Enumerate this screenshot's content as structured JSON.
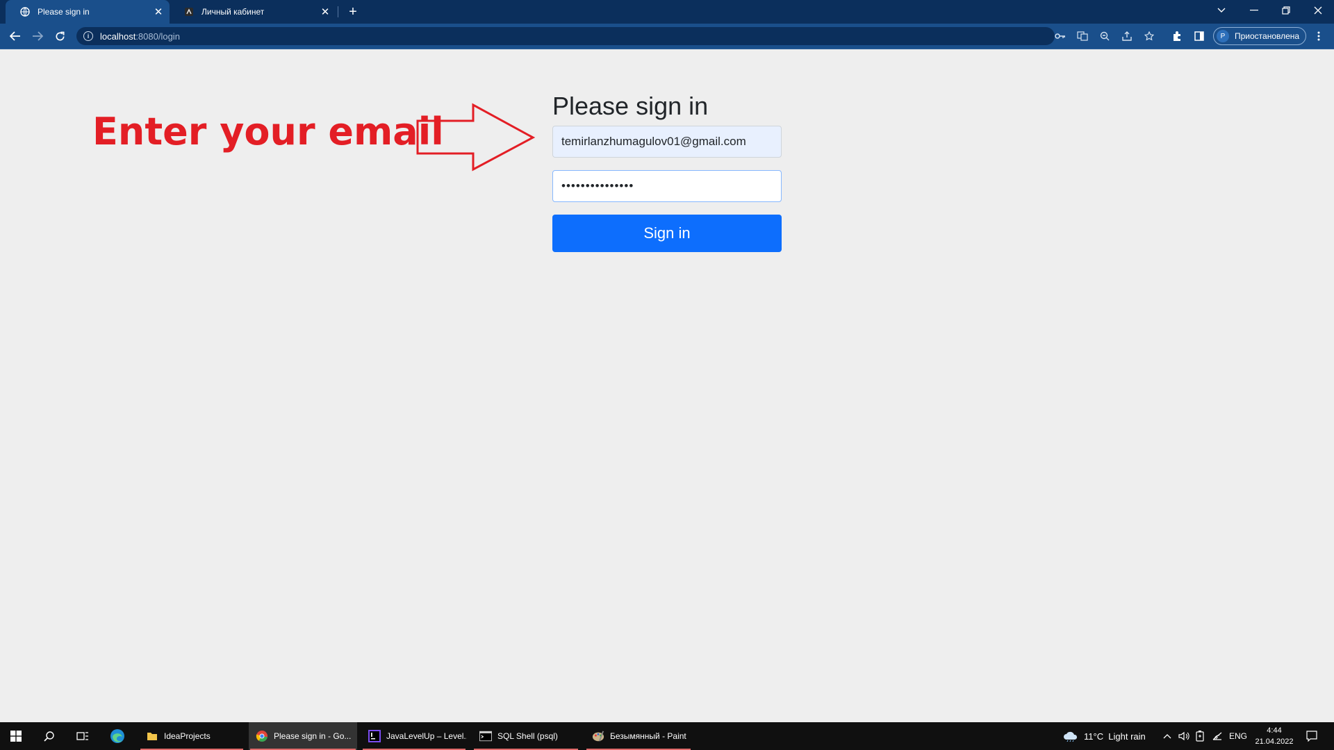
{
  "browser": {
    "tabs": [
      {
        "title": "Please sign in",
        "active": true
      },
      {
        "title": "Личный кабинет",
        "active": false
      }
    ],
    "address": {
      "host": "localhost",
      "path": ":8080/login"
    },
    "profile": {
      "initial": "P",
      "label": "Приостановлена"
    },
    "icons": [
      "key-icon",
      "translate-icon",
      "zoom-icon",
      "share-icon",
      "star-icon",
      "extensions-icon",
      "side-panel-icon",
      "menu-icon"
    ]
  },
  "page": {
    "annotation": "Enter your email",
    "title": "Please sign in",
    "email_value": "temirlanzhumagulov01@gmail.com",
    "password_value": "•••••••••••••••",
    "signin_label": "Sign in"
  },
  "taskbar": {
    "apps": [
      {
        "label": "IdeaProjects",
        "active": false
      },
      {
        "label": "Please sign in - Go...",
        "active": true
      },
      {
        "label": "JavaLevelUp – Level...",
        "active": false
      },
      {
        "label": "SQL Shell (psql)",
        "active": false
      },
      {
        "label": "Безымянный - Paint",
        "active": false
      }
    ],
    "weather": "11°C  Light rain",
    "language": "ENG",
    "time": "4:44",
    "date": "21.04.2022"
  },
  "colors": {
    "annotation": "#e31e25",
    "button": "#0d6efd",
    "tabbar": "#0b2f5c",
    "toolbar": "#1a4f8b"
  }
}
